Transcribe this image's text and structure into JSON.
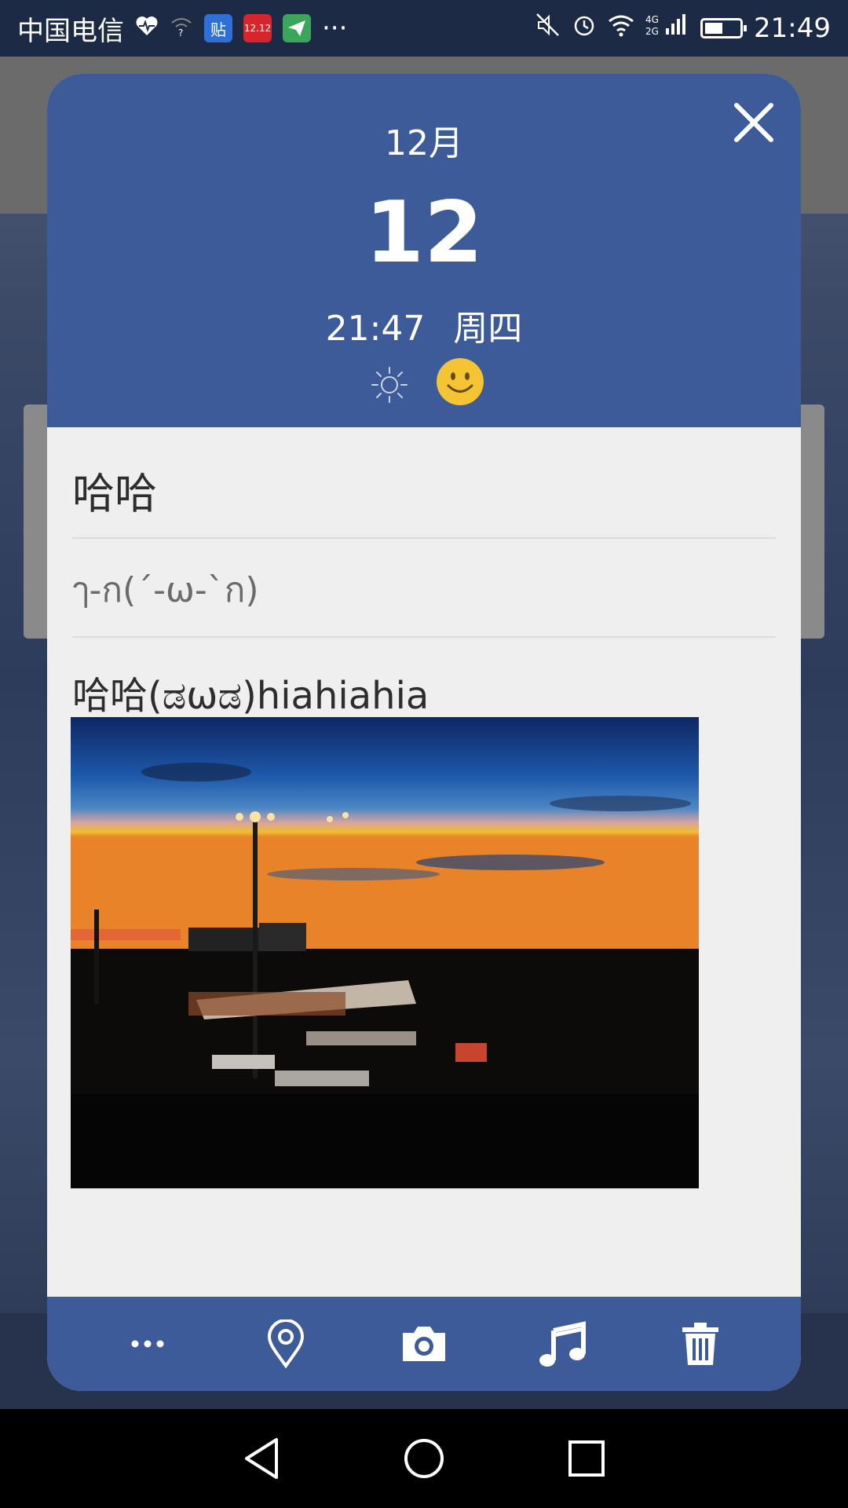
{
  "status_bar": {
    "carrier": "中国电信",
    "time": "21:49",
    "more": "···",
    "app_icons": [
      {
        "icon": "heart-pulse-icon"
      },
      {
        "icon": "wifi-question-icon"
      },
      {
        "icon": "tieba-app-icon",
        "label": "贴"
      },
      {
        "icon": "shopping-app-icon",
        "label": "12.12"
      },
      {
        "icon": "paper-plane-app-icon"
      }
    ],
    "system_icons": [
      "mute-icon",
      "alarm-icon",
      "wifi-icon",
      "signal-4g-2g-icon",
      "battery-icon"
    ]
  },
  "dialog": {
    "month": "12月",
    "day": "12",
    "time": "21:47",
    "weekday": "周四",
    "weather_icon": "sun-icon",
    "mood_icon": "smile-icon",
    "title": "哈哈",
    "subtitle": "ๅ-ก(ˊ-ω-ˋก)",
    "content": "哈哈(ಡωಡ)hiahiahia",
    "photo_alt": "airport-sunset-photo"
  },
  "toolbar": [
    {
      "icon": "more-icon"
    },
    {
      "icon": "location-pin-icon"
    },
    {
      "icon": "camera-icon"
    },
    {
      "icon": "music-note-icon"
    },
    {
      "icon": "trash-icon"
    }
  ],
  "nav_bar": [
    "back-icon",
    "home-icon",
    "recents-icon"
  ],
  "colors": {
    "header_blue": "#3d5a99",
    "body_bg": "#efefef",
    "status_bar_bg": "#1d2a45",
    "mood_yellow": "#f4c433"
  }
}
